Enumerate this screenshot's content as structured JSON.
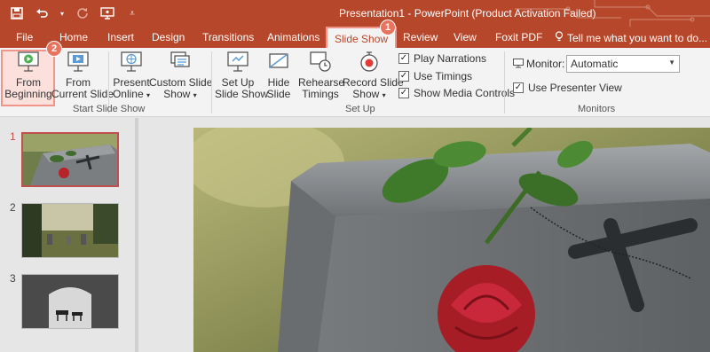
{
  "window": {
    "title": "Presentation1 - PowerPoint (Product Activation Failed)"
  },
  "quick_access": {
    "icons": [
      "save-icon",
      "undo-icon",
      "undo-dropdown-icon",
      "redo-icon",
      "start-from-beginning-icon",
      "customize-qat-icon"
    ]
  },
  "tabs": [
    {
      "label": "File"
    },
    {
      "label": "Home"
    },
    {
      "label": "Insert"
    },
    {
      "label": "Design"
    },
    {
      "label": "Transitions"
    },
    {
      "label": "Animations"
    },
    {
      "label": "Slide Show",
      "active": true
    },
    {
      "label": "Review"
    },
    {
      "label": "View"
    },
    {
      "label": "Foxit PDF"
    }
  ],
  "tell_me": "Tell me what you want to do...",
  "ribbon": {
    "start_group": {
      "label": "Start Slide Show",
      "from_beginning": {
        "line1": "From",
        "line2": "Beginning"
      },
      "from_current": {
        "line1": "From",
        "line2": "Current Slide"
      },
      "present_online": {
        "line1": "Present",
        "line2": "Online"
      },
      "custom_show": {
        "line1": "Custom Slide",
        "line2": "Show"
      }
    },
    "setup_group": {
      "label": "Set Up",
      "setup_show": {
        "line1": "Set Up",
        "line2": "Slide Show"
      },
      "hide_slide": {
        "line1": "Hide",
        "line2": "Slide"
      },
      "rehearse": {
        "line1": "Rehearse",
        "line2": "Timings"
      },
      "record": {
        "line1": "Record Slide",
        "line2": "Show"
      },
      "play_narrations": "Play Narrations",
      "use_timings": "Use Timings",
      "show_media_controls": "Show Media Controls"
    },
    "monitors_group": {
      "label": "Monitors",
      "monitor_label": "Monitor:",
      "monitor_value": "Automatic",
      "presenter_view": "Use Presenter View"
    }
  },
  "annotations": {
    "badge1": "1",
    "badge2": "2"
  },
  "slides": [
    {
      "number": "1",
      "active": true
    },
    {
      "number": "2"
    },
    {
      "number": "3"
    }
  ],
  "colors": {
    "accent": "#b7472a",
    "highlight": "#f1948a",
    "badge": "#e8735f"
  }
}
